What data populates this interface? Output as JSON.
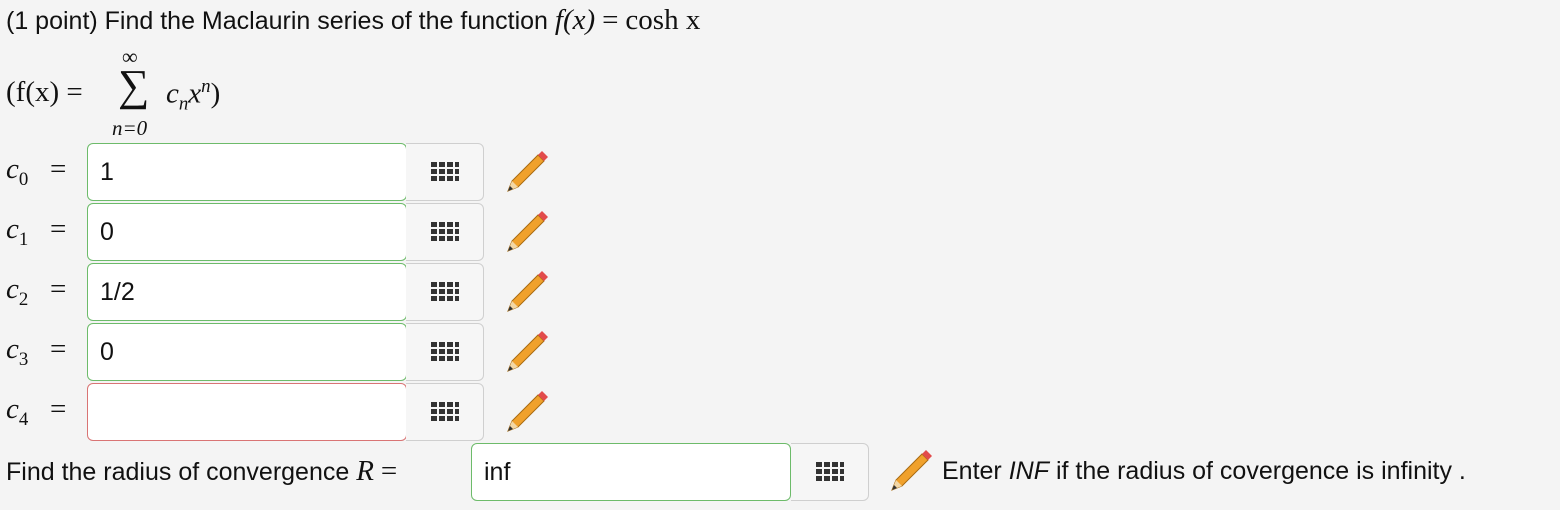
{
  "question": {
    "prefix": "(1 point) Find the Maclaurin series of the function",
    "func_lhs": "f(x)",
    "func_eq": "=",
    "func_rhs": "cosh x"
  },
  "series_def": {
    "lhs": "(f(x) =",
    "upper": "∞",
    "lower": "n=0",
    "term_c": "c",
    "term_sub": "n",
    "term_x": "x",
    "term_sup": "n",
    "close": ")"
  },
  "coefficients": [
    {
      "label": "c",
      "sub": "0",
      "eq": "=",
      "value": "1",
      "status": "correct"
    },
    {
      "label": "c",
      "sub": "1",
      "eq": "=",
      "value": "0",
      "status": "correct"
    },
    {
      "label": "c",
      "sub": "2",
      "eq": "=",
      "value": "1/2",
      "status": "correct"
    },
    {
      "label": "c",
      "sub": "3",
      "eq": "=",
      "value": "0",
      "status": "correct"
    },
    {
      "label": "c",
      "sub": "4",
      "eq": "=",
      "value": "",
      "status": "incorrect"
    }
  ],
  "radius": {
    "label_text": "Find the radius of convergence",
    "label_var": "R",
    "label_eq": "=",
    "value": "inf",
    "hint_pre": "Enter",
    "hint_em": "INF",
    "hint_post": "if the radius of covergence is infinity ."
  },
  "icons": {
    "palette": "grid-palette-icon",
    "pencil": "pencil-icon"
  },
  "colors": {
    "correct_border": "#6dbb6a",
    "incorrect_border": "#d97474"
  }
}
